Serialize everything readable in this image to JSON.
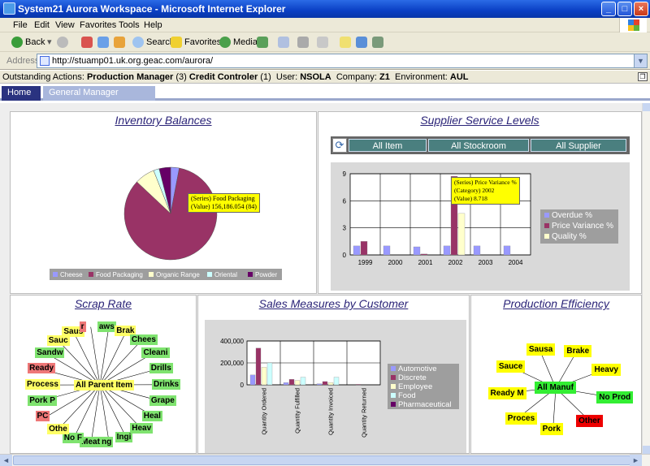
{
  "window": {
    "title": "System21 Aurora Workspace - Microsoft Internet Explorer",
    "minimize": "_",
    "maximize": "□",
    "close": "×"
  },
  "menu": [
    "File",
    "Edit",
    "View",
    "Favorites",
    "Tools",
    "Help"
  ],
  "toolbar": {
    "back": "Back",
    "search": "Search",
    "favorites": "Favorites",
    "media": "Media"
  },
  "address": {
    "label": "Address",
    "url": "http://stuamp01.uk.org.geac.com/aurora/"
  },
  "status": {
    "prefix": "Outstanding Actions:",
    "role1": "Production Manager",
    "count1": "(3)",
    "role2": "Credit Controler",
    "count2": "(1)",
    "user_label": "User:",
    "user": "NSOLA",
    "company_label": "Company:",
    "company": "Z1",
    "env_label": "Environment:",
    "env": "AUL"
  },
  "tabs": [
    "Home",
    "General Manager Dashboard"
  ],
  "inventory": {
    "title": "Inventory Balances",
    "tooltip": [
      "(Series) Food Packaging",
      "(Value) 156,186.054 (84)"
    ],
    "chart_data": {
      "type": "pie",
      "categories": [
        "Cheese",
        "Food Packaging",
        "Organic Range",
        "Oriental",
        "Powder"
      ],
      "values": [
        3,
        84,
        7,
        2,
        4
      ],
      "colors": [
        "#9999ff",
        "#993366",
        "#ffffcc",
        "#ccffff",
        "#660066"
      ]
    }
  },
  "supplier": {
    "title": "Supplier Service Levels",
    "buttons": [
      "All Item",
      "All Stockroom",
      "All Supplier"
    ],
    "tooltip": [
      "(Series) Price Variance %",
      "(Category) 2002",
      "(Value) 8.718"
    ],
    "chart_data": {
      "type": "bar",
      "categories": [
        "1999",
        "2000",
        "2001",
        "2002",
        "2003",
        "2004"
      ],
      "series": [
        {
          "name": "Overdue %",
          "values": [
            1,
            1,
            0.9,
            1,
            1,
            1
          ],
          "color": "#9999ff"
        },
        {
          "name": "Price Variance %",
          "values": [
            1.5,
            0,
            0.1,
            8.718,
            0,
            0
          ],
          "color": "#993366"
        },
        {
          "name": "Quality %",
          "values": [
            0,
            0,
            0,
            4.6,
            0,
            0
          ],
          "color": "#ffffcc"
        }
      ],
      "yticks": [
        "0",
        "3",
        "6",
        "9"
      ],
      "ylim": [
        0,
        9
      ]
    }
  },
  "scrap": {
    "title": "Scrap Rate",
    "center": "All Parent Item",
    "nodes": [
      {
        "t": "aws",
        "c": "g"
      },
      {
        "t": "Brak",
        "c": "y"
      },
      {
        "t": "Chees",
        "c": "g"
      },
      {
        "t": "Cleani",
        "c": "g"
      },
      {
        "t": "Drills",
        "c": "g"
      },
      {
        "t": "Drinks",
        "c": "g"
      },
      {
        "t": "Grape",
        "c": "g"
      },
      {
        "t": "Heal",
        "c": "g"
      },
      {
        "t": "Heav",
        "c": "g"
      },
      {
        "t": "Ingi",
        "c": "g"
      },
      {
        "t": "Ing",
        "c": "g"
      },
      {
        "t": "Meat",
        "c": "g"
      },
      {
        "t": "No F",
        "c": "g"
      },
      {
        "t": "Othe",
        "c": "y"
      },
      {
        "t": "PC",
        "c": "r"
      },
      {
        "t": "Pork P",
        "c": "g"
      },
      {
        "t": "Process",
        "c": "y"
      },
      {
        "t": "Ready",
        "c": "r"
      },
      {
        "t": "Sandw",
        "c": "g"
      },
      {
        "t": "Sauc",
        "c": "y"
      },
      {
        "t": "Saus",
        "c": "y"
      },
      {
        "t": "r",
        "c": "r"
      }
    ]
  },
  "sales": {
    "title": "Sales Measures by Customer",
    "chart_data": {
      "type": "bar",
      "categories": [
        "Quantity Ordered",
        "Quantity Fulfilled",
        "Quantity Invoiced",
        "Quantity Returned"
      ],
      "series": [
        {
          "name": "Automotive",
          "values": [
            90000,
            20000,
            10000,
            0
          ],
          "color": "#9999ff"
        },
        {
          "name": "Discrete",
          "values": [
            335000,
            50000,
            30000,
            5000
          ],
          "color": "#993366"
        },
        {
          "name": "Employee",
          "values": [
            160000,
            40000,
            20000,
            0
          ],
          "color": "#ffffcc"
        },
        {
          "name": "Food",
          "values": [
            200000,
            70000,
            70000,
            0
          ],
          "color": "#ccffff"
        },
        {
          "name": "Pharmaceutical",
          "values": [
            0,
            0,
            0,
            0
          ],
          "color": "#660066"
        }
      ],
      "yticks": [
        "0",
        "200,000",
        "400,000"
      ],
      "ylim": [
        0,
        400000
      ]
    }
  },
  "production": {
    "title": "Production Efficiency",
    "center": "All Manuf",
    "nodes": [
      {
        "t": "Sausa",
        "c": "py"
      },
      {
        "t": "Brake",
        "c": "py"
      },
      {
        "t": "Heavy",
        "c": "py"
      },
      {
        "t": "No Prod",
        "c": "pg2"
      },
      {
        "t": "Other",
        "c": "pr"
      },
      {
        "t": "Pork",
        "c": "py"
      },
      {
        "t": "Proces",
        "c": "py"
      },
      {
        "t": "Ready M",
        "c": "py"
      },
      {
        "t": "Sauce",
        "c": "py"
      }
    ]
  }
}
